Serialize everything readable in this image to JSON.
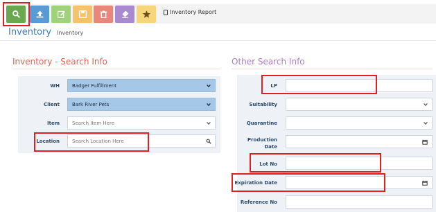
{
  "toolbar": {
    "buttons": [
      {
        "name": "search",
        "color": "#6aa84f"
      },
      {
        "name": "upload",
        "color": "#5b9bd5"
      },
      {
        "name": "edit",
        "color": "#9fd27a"
      },
      {
        "name": "save",
        "color": "#f6c26b"
      },
      {
        "name": "delete",
        "color": "#e8877a"
      },
      {
        "name": "eraser",
        "color": "#a98ad0"
      },
      {
        "name": "favorite",
        "color": "#f7d57a"
      }
    ],
    "report_label": "Inventory Report"
  },
  "page": {
    "title": "Inventory",
    "breadcrumb": "Inventory"
  },
  "search_info": {
    "title": "Inventory - Search Info",
    "wh": {
      "label": "WH",
      "value": "Badger Fulfillment"
    },
    "client": {
      "label": "Client",
      "value": "Bark River Pets"
    },
    "item": {
      "label": "Item",
      "placeholder": "Search Item Here"
    },
    "location": {
      "label": "Location",
      "placeholder": "Search Location Here"
    }
  },
  "other_info": {
    "title": "Other Search Info",
    "lp": {
      "label": "LP"
    },
    "suitability": {
      "label": "Suitability"
    },
    "quarantine": {
      "label": "Quarantine"
    },
    "production_date": {
      "label_line1": "Production",
      "label_line2": "Date"
    },
    "lot_no": {
      "label": "Lot No"
    },
    "expiration_date": {
      "label": "Expiration Date"
    },
    "reference_no": {
      "label": "Reference No"
    }
  },
  "colors": {
    "accent_blue": "#3a7bbf",
    "section_left": "#e0654f",
    "section_right": "#b07cc6",
    "highlight": "#e02020"
  }
}
